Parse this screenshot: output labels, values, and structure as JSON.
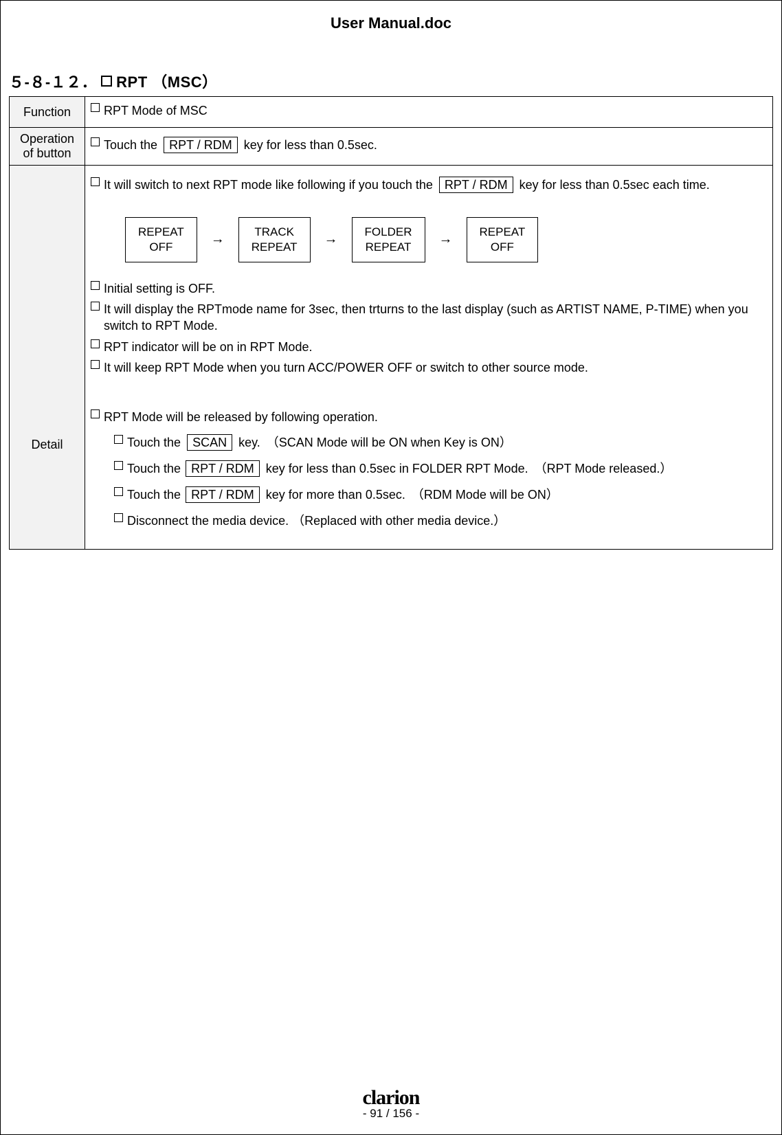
{
  "doc_title": "User Manual.doc",
  "section": {
    "number": "５-８-１２．",
    "title": "RPT （MSC）"
  },
  "rows": {
    "function": {
      "label": "Function",
      "text": "RPT Mode of MSC"
    },
    "operation": {
      "label_line1": "Operation",
      "label_line2": "of button",
      "pre": "Touch the",
      "key": "RPT / RDM",
      "post": "key for less than 0.5sec."
    }
  },
  "detail": {
    "label": "Detail",
    "intro_pre": "It will switch to next RPT mode like following if you touch the",
    "intro_key": "RPT / RDM",
    "intro_post": "key for less than 0.5sec each time.",
    "flow": {
      "b1_l1": "REPEAT",
      "b1_l2": "OFF",
      "b2_l1": "TRACK",
      "b2_l2": "REPEAT",
      "b3_l1": "FOLDER",
      "b3_l2": "REPEAT",
      "b4_l1": "REPEAT",
      "b4_l2": "OFF",
      "arrow": "→"
    },
    "bullets": {
      "a": "Initial setting is OFF.",
      "b": "It will display the RPTmode name for 3sec, then trturns to the last display (such as ARTIST NAME, P-TIME) when you switch to RPT Mode.",
      "c": "RPT indicator will be on in RPT Mode.",
      "d": "It will keep RPT Mode when you turn ACC/POWER OFF or switch to other source mode."
    },
    "release_intro": "RPT Mode will be released by following operation.",
    "release": {
      "r1_pre": "Touch the",
      "r1_key": "SCAN",
      "r1_post": "key.　（SCAN Mode will be ON when Key is ON）",
      "r2_pre": "Touch the",
      "r2_key": "RPT / RDM",
      "r2_post": "key for less than 0.5sec in FOLDER RPT Mode.　（RPT Mode released.）",
      "r3_pre": "Touch the",
      "r3_key": "RPT / RDM",
      "r3_post": "key for more than 0.5sec.　（RDM Mode will be ON）",
      "r4": "Disconnect the media device. （Replaced with other media device.）"
    }
  },
  "footer": {
    "brand": "clarion",
    "page": "- 91 / 156 -"
  }
}
